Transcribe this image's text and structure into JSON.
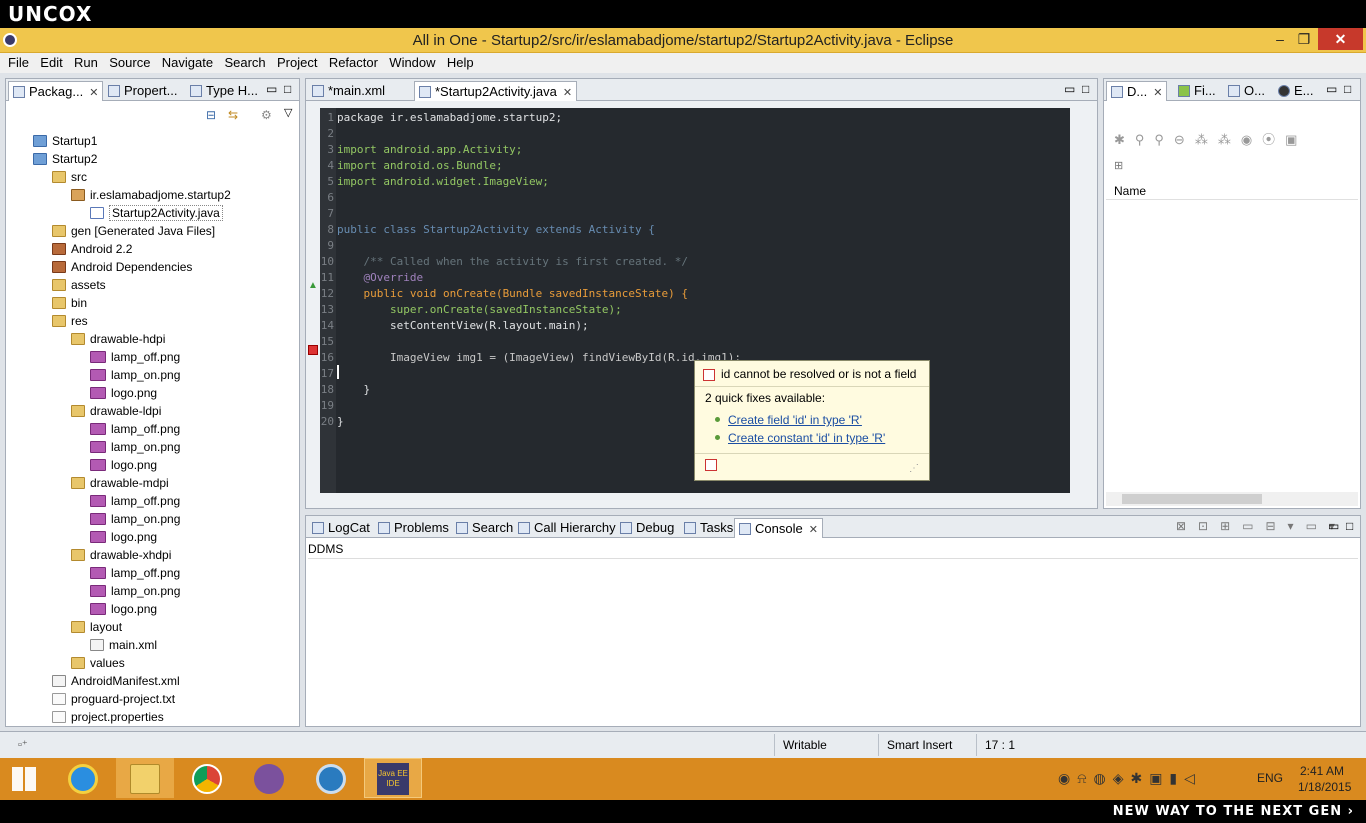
{
  "brand": {
    "top": "UNCOX",
    "bottom": "NEW WAY TO THE NEXT GEN ›"
  },
  "window": {
    "title": "All in One - Startup2/src/ir/eslamabadjome/startup2/Startup2Activity.java - Eclipse",
    "min": "–",
    "max": "❐",
    "close": "✕"
  },
  "menu": [
    "File",
    "Edit",
    "Run",
    "Source",
    "Navigate",
    "Search",
    "Project",
    "Refactor",
    "Window",
    "Help"
  ],
  "left_tabs": [
    "Packag...",
    "Propert...",
    "Type H..."
  ],
  "tree": [
    {
      "label": "Startup1",
      "icon": "proj"
    },
    {
      "label": "Startup2",
      "icon": "proj"
    },
    {
      "label": "src",
      "icon": "folder"
    },
    {
      "label": "ir.eslamabadjome.startup2",
      "icon": "pkg"
    },
    {
      "label": "Startup2Activity.java",
      "icon": "java"
    },
    {
      "label": "gen [Generated Java Files]",
      "icon": "folder"
    },
    {
      "label": "Android 2.2",
      "icon": "jar"
    },
    {
      "label": "Android Dependencies",
      "icon": "jar"
    },
    {
      "label": "assets",
      "icon": "folder"
    },
    {
      "label": "bin",
      "icon": "folder"
    },
    {
      "label": "res",
      "icon": "folder"
    },
    {
      "label": "drawable-hdpi",
      "icon": "folder"
    },
    {
      "label": "lamp_off.png",
      "icon": "png"
    },
    {
      "label": "lamp_on.png",
      "icon": "png"
    },
    {
      "label": "logo.png",
      "icon": "png"
    },
    {
      "label": "drawable-ldpi",
      "icon": "folder"
    },
    {
      "label": "lamp_off.png",
      "icon": "png"
    },
    {
      "label": "lamp_on.png",
      "icon": "png"
    },
    {
      "label": "logo.png",
      "icon": "png"
    },
    {
      "label": "drawable-mdpi",
      "icon": "folder"
    },
    {
      "label": "lamp_off.png",
      "icon": "png"
    },
    {
      "label": "lamp_on.png",
      "icon": "png"
    },
    {
      "label": "logo.png",
      "icon": "png"
    },
    {
      "label": "drawable-xhdpi",
      "icon": "folder"
    },
    {
      "label": "lamp_off.png",
      "icon": "png"
    },
    {
      "label": "lamp_on.png",
      "icon": "png"
    },
    {
      "label": "logo.png",
      "icon": "png"
    },
    {
      "label": "layout",
      "icon": "folder"
    },
    {
      "label": "main.xml",
      "icon": "xml"
    },
    {
      "label": "values",
      "icon": "folder"
    },
    {
      "label": "AndroidManifest.xml",
      "icon": "xml"
    },
    {
      "label": "proguard-project.txt",
      "icon": "file"
    },
    {
      "label": "project.properties",
      "icon": "file"
    }
  ],
  "editor_tabs": [
    "*main.xml",
    "*Startup2Activity.java"
  ],
  "code": {
    "lines": [
      "1",
      "2",
      "3",
      "4",
      "5",
      "6",
      "7",
      "8",
      "9",
      "10",
      "11",
      "12",
      "13",
      "14",
      "15",
      "16",
      "17",
      "18",
      "19",
      "20"
    ],
    "l1": "package ir.eslamabadjome.startup2;",
    "l3": "import android.app.Activity;",
    "l4": "import android.os.Bundle;",
    "l5": "import android.widget.ImageView;",
    "l8": "public class Startup2Activity extends Activity {",
    "l10": "    /** Called when the activity is first created. */",
    "l11": "    @Override",
    "l12": "    public void onCreate(Bundle savedInstanceState) {",
    "l13": "        super.onCreate(savedInstanceState);",
    "l14": "        setContentView(R.layout.main);",
    "l16": "        ImageView img1 = (ImageView) findViewById(R.id.img1);",
    "l18": "    }",
    "l20": "}"
  },
  "hover": {
    "title": "id cannot be resolved or is not a field",
    "subtitle": "2 quick fixes available:",
    "fixes": [
      "Create field 'id' in type 'R'",
      "Create constant 'id' in type 'R'"
    ]
  },
  "right_tabs": [
    "D...",
    "Fi...",
    "O...",
    "E..."
  ],
  "right": {
    "column": "Name"
  },
  "bottom_tabs": [
    "LogCat",
    "Problems",
    "Search",
    "Call Hierarchy",
    "Debug",
    "Tasks",
    "Console"
  ],
  "console": {
    "name": "DDMS"
  },
  "status": {
    "writable": "Writable",
    "insert": "Smart Insert",
    "position": "17 : 1"
  },
  "tray": {
    "lang": "ENG",
    "time": "2:41 AM",
    "date": "1/18/2015"
  },
  "taskbar_java": "Java EE IDE",
  "colors": {
    "titlebar": "#f0c64c",
    "taskbar": "#d98a1f",
    "editor_bg": "#25292e",
    "close": "#c7392b"
  }
}
